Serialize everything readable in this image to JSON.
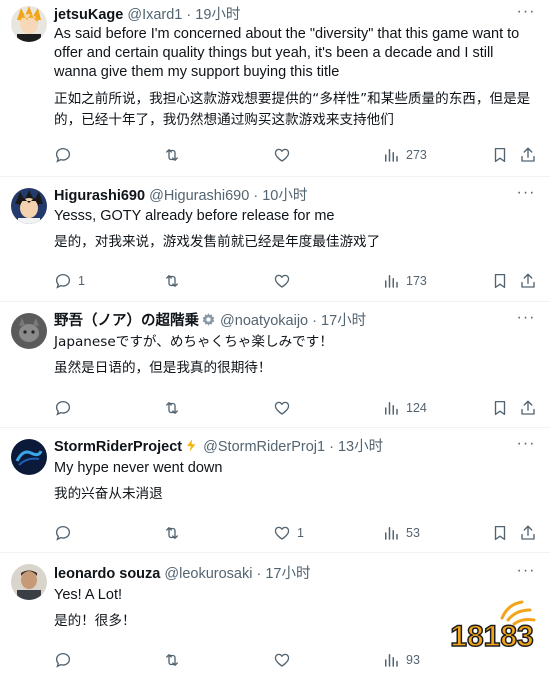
{
  "tweets": [
    {
      "name": "jetsuKage",
      "handle": "@Ixard1",
      "dot": "·",
      "time": "19小时",
      "text_en": "As said before I'm concerned about the \"diversity\" that this game want to offer and certain quality things but yeah, it's been a decade and I still wanna give them my support buying this title",
      "text_cn": "正如之前所说，我担心这款游戏想要提供的“多样性”和某些质量的东西，但是是的，已经十年了，我仍然想通过购买这款游戏来支持他们",
      "replies": "",
      "likes": "",
      "views": "273"
    },
    {
      "name": "Higurashi690",
      "handle": "@Higurashi690",
      "dot": "·",
      "time": "10小时",
      "text_en": "Yesss, GOTY already before release for me",
      "text_cn": "是的，对我来说，游戏发售前就已经是年度最佳游戏了",
      "replies": "1",
      "likes": "",
      "views": "173"
    },
    {
      "name": "野吾（ノア）の超階乗",
      "handle": "@noatyokaijo",
      "dot": "·",
      "time": "17小时",
      "text_en": "Japaneseですが、めちゃくちゃ楽しみです！",
      "text_cn": "虽然是日语的，但是我真的很期待！",
      "replies": "",
      "likes": "",
      "views": "124"
    },
    {
      "name": "StormRiderProject",
      "handle": "@StormRiderProj1",
      "dot": "·",
      "time": "13小时",
      "text_en": "My hype never went down",
      "text_cn": "我的兴奋从未消退",
      "replies": "",
      "likes": "1",
      "views": "53"
    },
    {
      "name": "leonardo souza",
      "handle": "@leokurosaki",
      "dot": "·",
      "time": "17小时",
      "text_en": "Yes! A Lot!",
      "text_cn": "是的！很多！",
      "replies": "",
      "likes": "",
      "views": "93"
    }
  ],
  "watermark": "18183",
  "colors": {
    "text": "#0f1419",
    "secondary": "#536471",
    "divider": "#eff3f4",
    "watermark_orange": "#f2a51a"
  }
}
